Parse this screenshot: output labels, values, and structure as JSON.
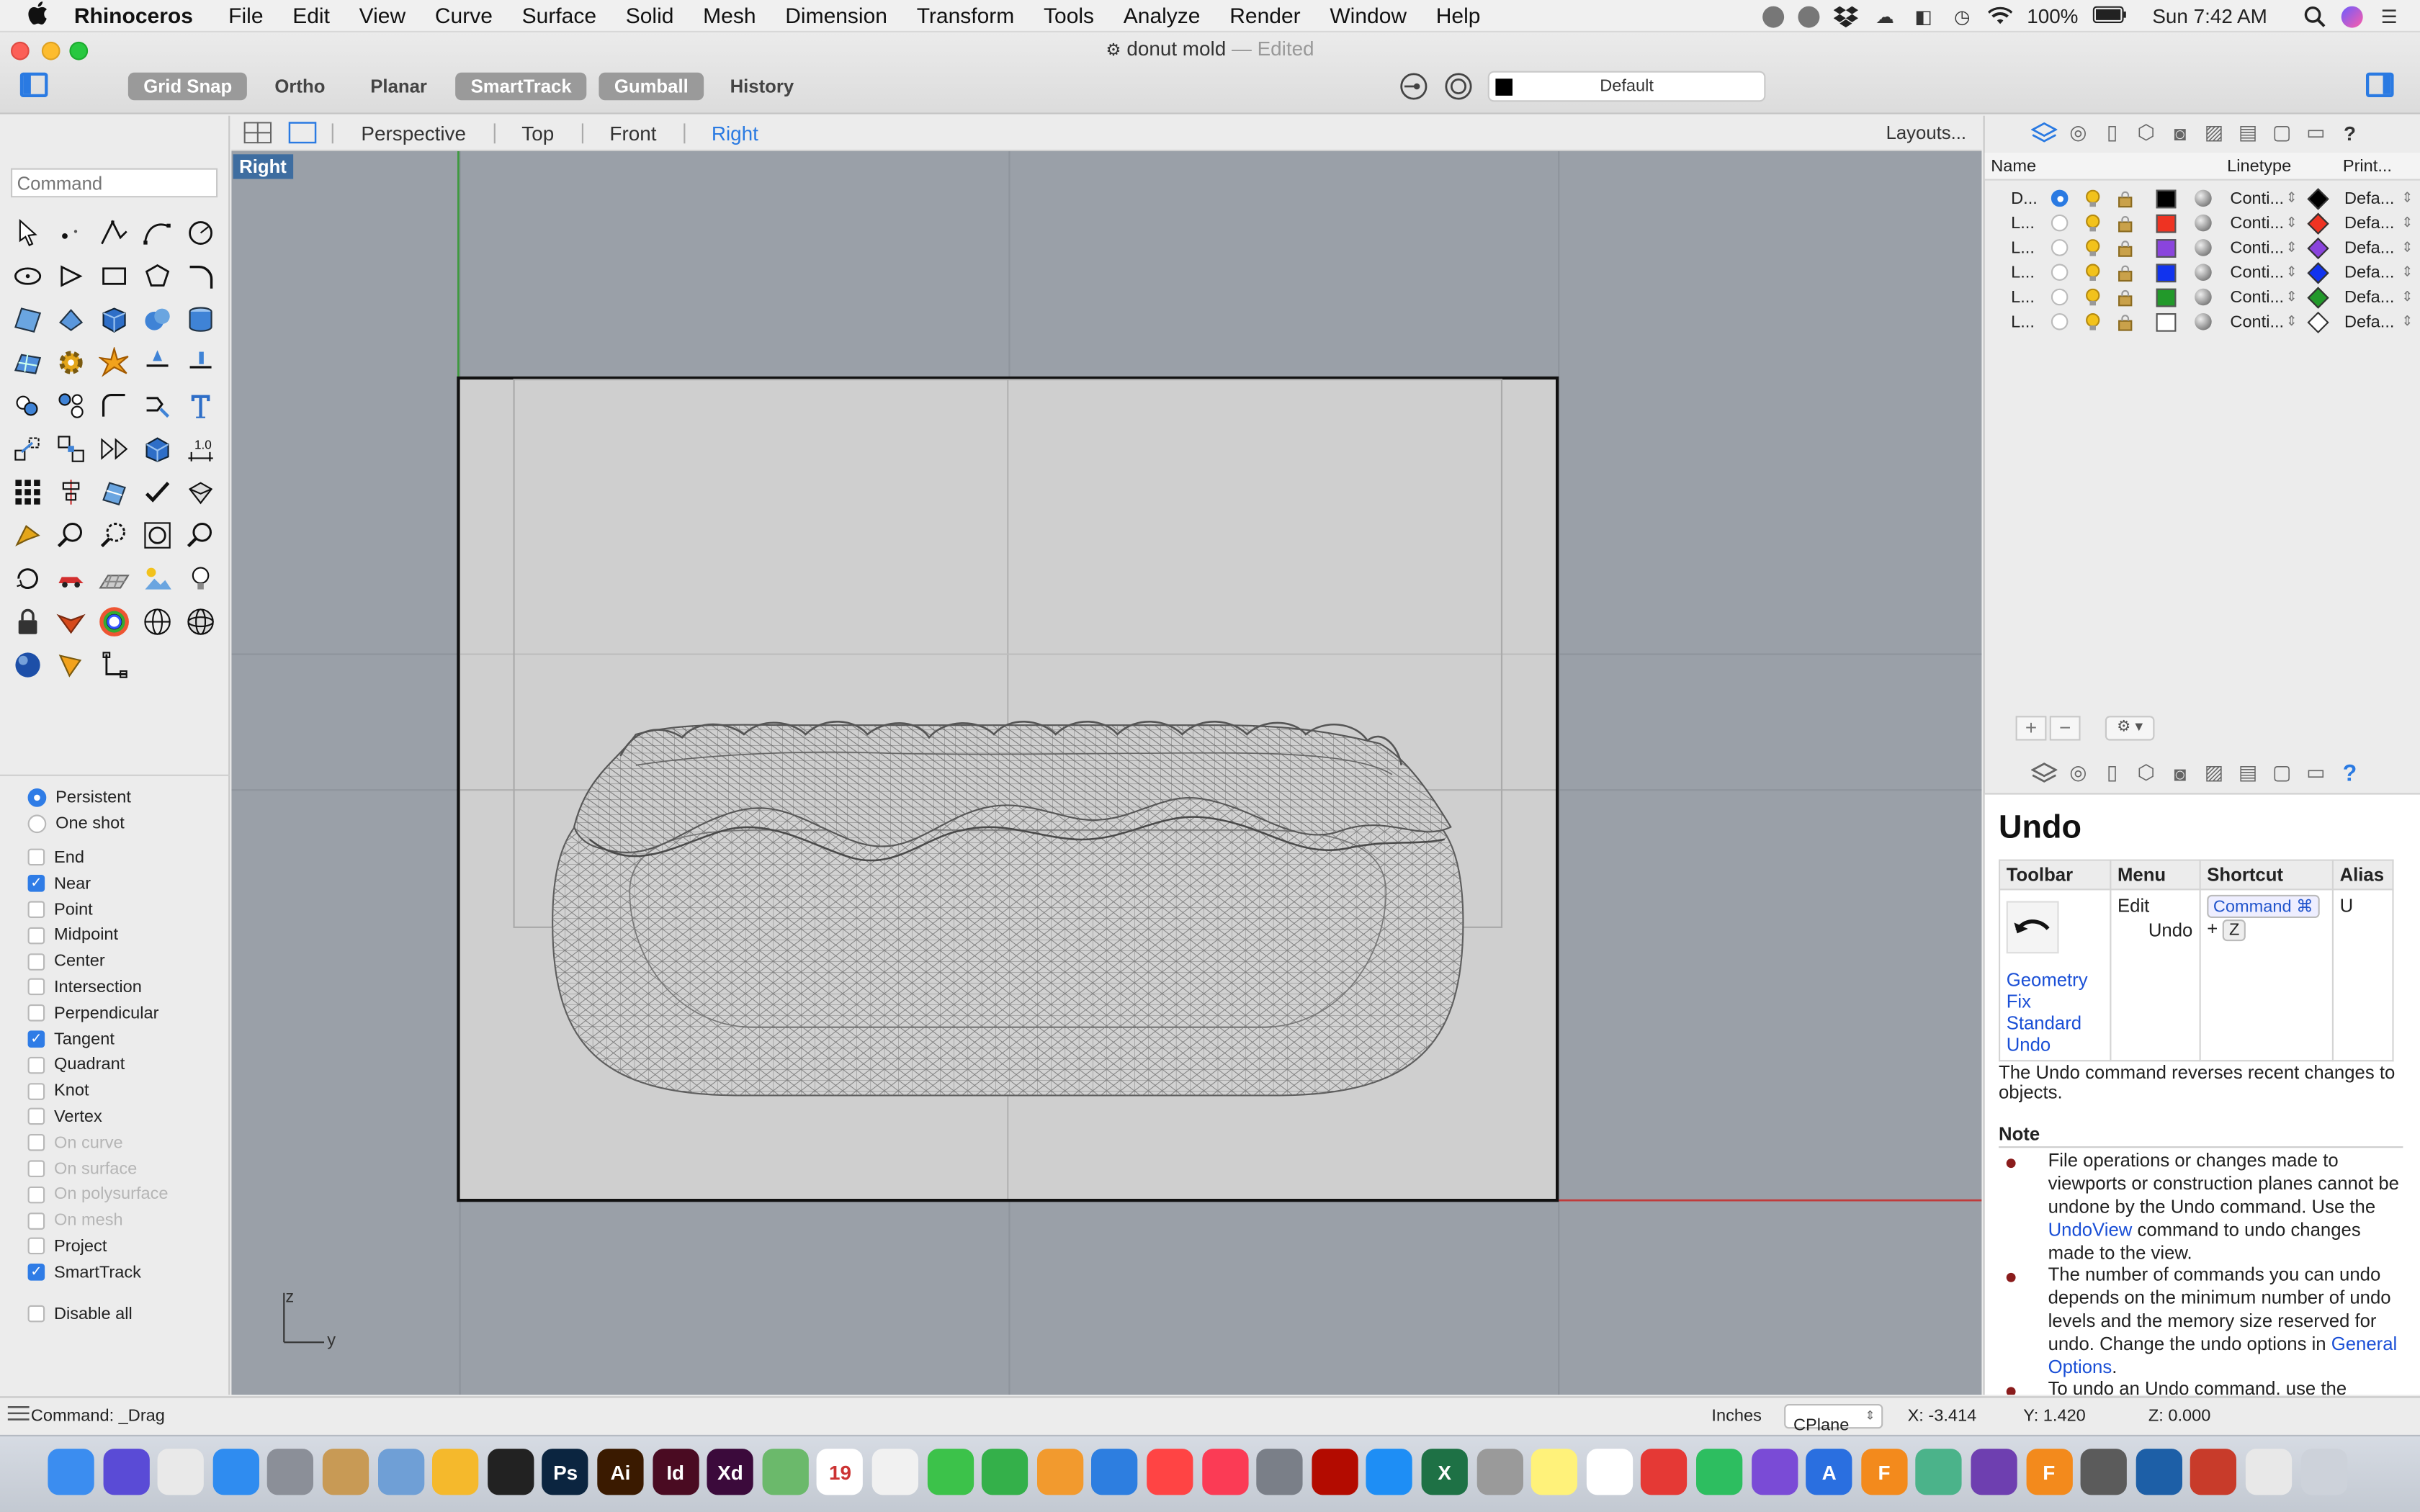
{
  "menubar": {
    "apple": "",
    "app": "Rhinoceros",
    "items": [
      "File",
      "Edit",
      "View",
      "Curve",
      "Surface",
      "Solid",
      "Mesh",
      "Dimension",
      "Transform",
      "Tools",
      "Analyze",
      "Render",
      "Window",
      "Help"
    ],
    "battery": "100%",
    "clock": "Sun 7:42 AM"
  },
  "window": {
    "title": "donut mold",
    "edited": "— Edited"
  },
  "toolbar": {
    "grid_snap": "Grid Snap",
    "ortho": "Ortho",
    "planar": "Planar",
    "smarttrack": "SmartTrack",
    "gumball": "Gumball",
    "history": "History",
    "layer": "Default"
  },
  "command": {
    "placeholder": "Command"
  },
  "osnap": {
    "persistent": "Persistent",
    "one_shot": "One shot",
    "items": [
      {
        "label": "End",
        "checked": false,
        "dim": false
      },
      {
        "label": "Near",
        "checked": true,
        "dim": false
      },
      {
        "label": "Point",
        "checked": false,
        "dim": false
      },
      {
        "label": "Midpoint",
        "checked": false,
        "dim": false
      },
      {
        "label": "Center",
        "checked": false,
        "dim": false
      },
      {
        "label": "Intersection",
        "checked": false,
        "dim": false
      },
      {
        "label": "Perpendicular",
        "checked": false,
        "dim": false
      },
      {
        "label": "Tangent",
        "checked": true,
        "dim": false
      },
      {
        "label": "Quadrant",
        "checked": false,
        "dim": false
      },
      {
        "label": "Knot",
        "checked": false,
        "dim": false
      },
      {
        "label": "Vertex",
        "checked": false,
        "dim": false
      },
      {
        "label": "On curve",
        "checked": false,
        "dim": true
      },
      {
        "label": "On surface",
        "checked": false,
        "dim": true
      },
      {
        "label": "On polysurface",
        "checked": false,
        "dim": true
      },
      {
        "label": "On mesh",
        "checked": false,
        "dim": true
      },
      {
        "label": "Project",
        "checked": false,
        "dim": false
      },
      {
        "label": "SmartTrack",
        "checked": true,
        "dim": false
      }
    ],
    "disable_all": "Disable all"
  },
  "viewtabs": {
    "perspective": "Perspective",
    "top": "Top",
    "front": "Front",
    "right": "Right",
    "layouts": "Layouts..."
  },
  "viewport": {
    "label": "Right",
    "axis_z": "z",
    "axis_y": "y"
  },
  "layers": {
    "col_name": "Name",
    "col_linetype": "Linetype",
    "col_print": "Print...",
    "rows": [
      {
        "name": "D...",
        "current": true,
        "color": "#000000",
        "linetype": "Conti...",
        "print_color": "#000000",
        "print_width": "Defa..."
      },
      {
        "name": "L...",
        "current": false,
        "color": "#ee3322",
        "linetype": "Conti...",
        "print_color": "#ee3322",
        "print_width": "Defa..."
      },
      {
        "name": "L...",
        "current": false,
        "color": "#8a44dd",
        "linetype": "Conti...",
        "print_color": "#8a44dd",
        "print_width": "Defa..."
      },
      {
        "name": "L...",
        "current": false,
        "color": "#1133ee",
        "linetype": "Conti...",
        "print_color": "#1133ee",
        "print_width": "Defa..."
      },
      {
        "name": "L...",
        "current": false,
        "color": "#22992a",
        "linetype": "Conti...",
        "print_color": "#22992a",
        "print_width": "Defa..."
      },
      {
        "name": "L...",
        "current": false,
        "color": "#ffffff",
        "linetype": "Conti...",
        "print_color": "#ffffff",
        "print_width": "Defa..."
      }
    ]
  },
  "help": {
    "title": "Undo",
    "col_toolbar": "Toolbar",
    "col_menu": "Menu",
    "col_shortcut": "Shortcut",
    "col_alias": "Alias",
    "toolbar_links": [
      "Geometry Fix",
      "Standard",
      "Undo"
    ],
    "menu_1": "Edit",
    "menu_2": "Undo",
    "shortcut_key1": "Command ⌘",
    "shortcut_plus": "+",
    "shortcut_key2": "Z",
    "alias": "U",
    "description": "The Undo command reverses recent changes to objects.",
    "note": "Note",
    "bullet1_a": "File operations or changes made to viewports or construction planes cannot be undone by the Undo command. Use the ",
    "bullet1_link": "UndoView",
    "bullet1_b": " command to undo changes made to the view.",
    "bullet2_a": "The number of commands you can undo depends on the minimum number of undo levels and the memory size reserved for undo. Change the undo options in ",
    "bullet2_link": "General Options",
    "bullet2_b": ".",
    "bullet3": "To undo an Undo command, use the"
  },
  "statusbar": {
    "command": "Command: _Drag",
    "units": "Inches",
    "cplane": "CPlane",
    "x": "X: -3.414",
    "y": "Y: 1.420",
    "z": "Z: 0.000"
  },
  "dock": [
    {
      "name": "finder-icon",
      "color": "#3b8df0",
      "label": ""
    },
    {
      "name": "siri-icon",
      "color": "#5a4bd6",
      "label": ""
    },
    {
      "name": "chrome-icon",
      "color": "#e9e9e9",
      "label": ""
    },
    {
      "name": "safari-icon",
      "color": "#2f8cf0",
      "label": ""
    },
    {
      "name": "launchpad-icon",
      "color": "#8b8f98",
      "label": ""
    },
    {
      "name": "books-icon",
      "color": "#c89a55",
      "label": ""
    },
    {
      "name": "preview-icon",
      "color": "#6f9fd6",
      "label": ""
    },
    {
      "name": "sketch-icon",
      "color": "#f5b92c",
      "label": ""
    },
    {
      "name": "figma-icon",
      "color": "#222",
      "label": ""
    },
    {
      "name": "photoshop-icon",
      "color": "#0b2540",
      "label": "Ps"
    },
    {
      "name": "illustrator-icon",
      "color": "#3a1a00",
      "label": "Ai"
    },
    {
      "name": "indesign-icon",
      "color": "#4a0b22",
      "label": "Id"
    },
    {
      "name": "xd-icon",
      "color": "#3b0a3b",
      "label": "Xd"
    },
    {
      "name": "maps-icon",
      "color": "#6bb96b",
      "label": ""
    },
    {
      "name": "calendar-icon",
      "color": "#ffffff",
      "label": "19"
    },
    {
      "name": "photos-icon",
      "color": "#f1f1f1",
      "label": ""
    },
    {
      "name": "messages-icon",
      "color": "#3cc24a",
      "label": ""
    },
    {
      "name": "facetime-icon",
      "color": "#34b04a",
      "label": ""
    },
    {
      "name": "pages-icon",
      "color": "#f29a2e",
      "label": ""
    },
    {
      "name": "keynote-icon",
      "color": "#2d7ee0",
      "label": ""
    },
    {
      "name": "news-icon",
      "color": "#f44",
      "label": ""
    },
    {
      "name": "music-icon",
      "color": "#fb3b55",
      "label": ""
    },
    {
      "name": "system-preferences-icon",
      "color": "#7a7f88",
      "label": ""
    },
    {
      "name": "acrobat-icon",
      "color": "#b30b00",
      "label": ""
    },
    {
      "name": "app-store-icon",
      "color": "#1e8ef5",
      "label": ""
    },
    {
      "name": "excel-icon",
      "color": "#1e7145",
      "label": "X"
    },
    {
      "name": "script-editor-icon",
      "color": "#9a9a9a",
      "label": ""
    },
    {
      "name": "notes-icon",
      "color": "#fff27a",
      "label": ""
    },
    {
      "name": "slack-icon",
      "color": "#ffffff",
      "label": ""
    },
    {
      "name": "sketchbook-icon",
      "color": "#e53935",
      "label": ""
    },
    {
      "name": "evernote-icon",
      "color": "#2dbe60",
      "label": ""
    },
    {
      "name": "pocket-icon",
      "color": "#7a4bd6",
      "label": ""
    },
    {
      "name": "typeface-icon",
      "color": "#2a6fe0",
      "label": "A"
    },
    {
      "name": "fusion-icon",
      "color": "#f38a1c",
      "label": "F"
    },
    {
      "name": "atom-icon",
      "color": "#4bb38a",
      "label": ""
    },
    {
      "name": "github-icon",
      "color": "#6e3fb0",
      "label": ""
    },
    {
      "name": "fusion-360-icon",
      "color": "#f38a1c",
      "label": "F"
    },
    {
      "name": "rhino-icon",
      "color": "#5b5b5b",
      "label": ""
    },
    {
      "name": "virtualbox-icon",
      "color": "#1d5fa7",
      "label": ""
    },
    {
      "name": "bird-app-icon",
      "color": "#c83b2a",
      "label": ""
    },
    {
      "name": "downloads-icon",
      "color": "#e8e8e8",
      "label": ""
    },
    {
      "name": "trash-icon",
      "color": "#cdd2da",
      "label": ""
    }
  ]
}
